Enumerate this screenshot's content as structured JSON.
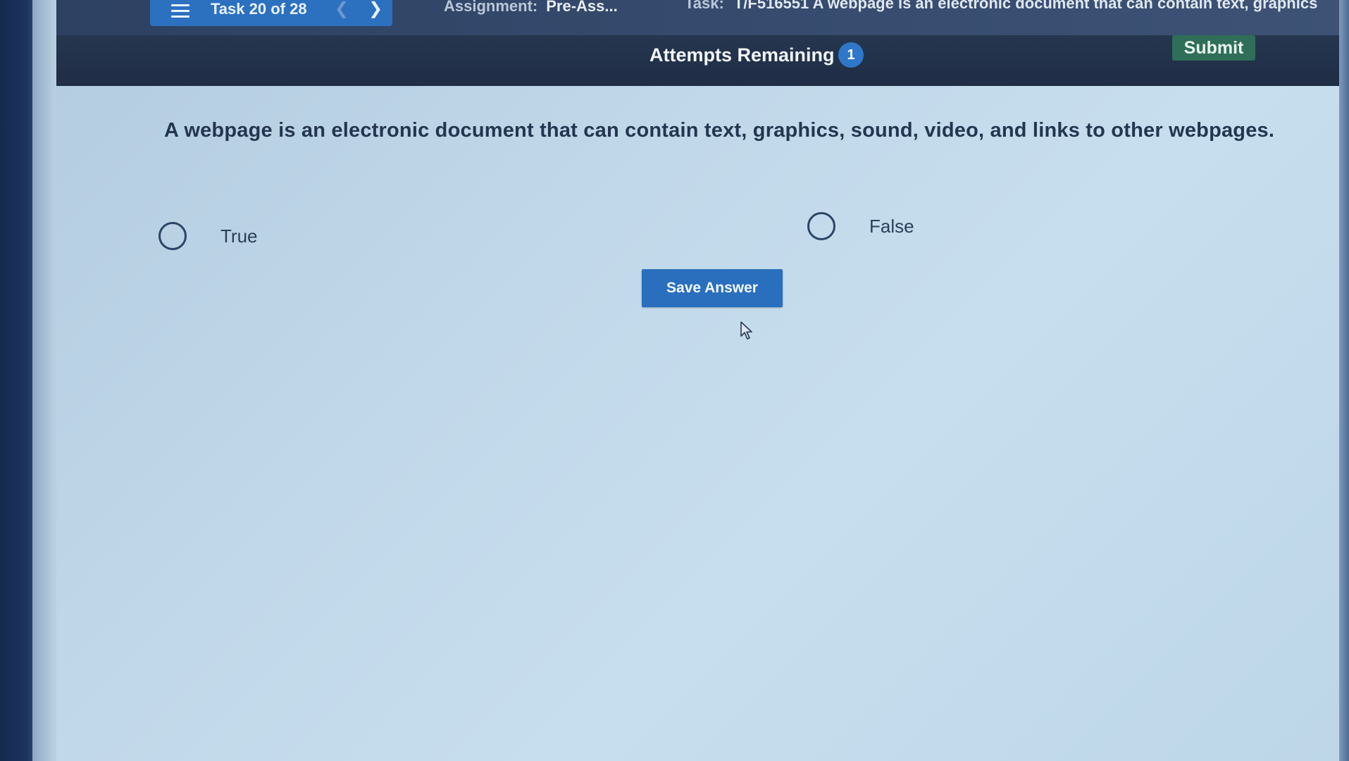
{
  "topbar": {
    "task_label": "Task 20 of 28",
    "prev_icon": "chevron-left-icon",
    "next_icon": "chevron-right-icon",
    "menu_icon": "hamburger-menu-icon",
    "assignment_key": "Assignment:",
    "assignment_value": "Pre-Ass...",
    "task_key": "Task:",
    "task_value": "T/F516551 A webpage is an electronic document that can contain text, graphics"
  },
  "status_bar": {
    "attempts_label": "Attempts Remaining",
    "attempts_count": "1",
    "submit_label": "Submit"
  },
  "question": {
    "text": "A webpage is an electronic document that can contain text, graphics, sound, video, and links to other webpages.",
    "options": [
      {
        "label": "True",
        "selected": false
      },
      {
        "label": "False",
        "selected": false
      }
    ],
    "save_label": "Save Answer"
  },
  "colors": {
    "accent_blue": "#2a6fbd",
    "submit_green": "#2f6e58",
    "header_dark": "#1f2d45"
  }
}
